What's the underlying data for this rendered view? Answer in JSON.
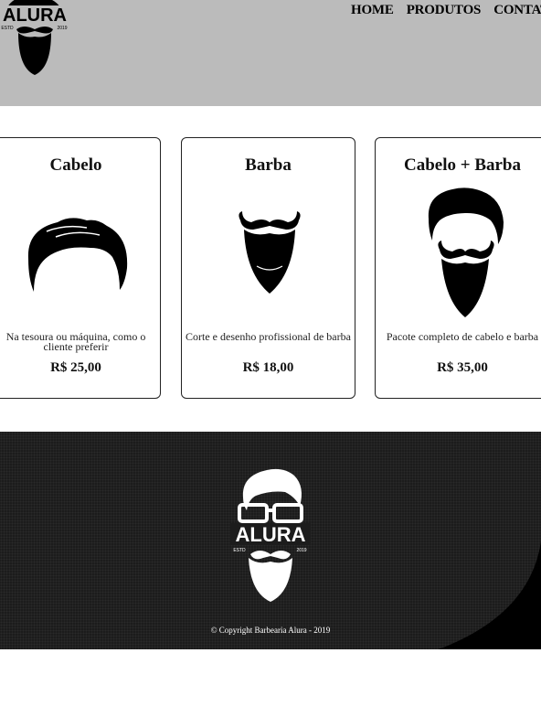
{
  "header": {
    "logo_text": "ALURA",
    "logo_left": "ESTD",
    "logo_right": "2019",
    "nav": [
      "HOME",
      "PRODUTOS",
      "CONTATO"
    ]
  },
  "cards": [
    {
      "title": "Cabelo",
      "desc": "Na tesoura ou máquina, como o cliente preferir",
      "price": "R$ 25,00",
      "icon": "hair-icon"
    },
    {
      "title": "Barba",
      "desc": "Corte e desenho profissional de barba",
      "price": "R$ 18,00",
      "icon": "beard-icon"
    },
    {
      "title": "Cabelo + Barba",
      "desc": "Pacote completo de cabelo e barba",
      "price": "R$ 35,00",
      "icon": "hair-beard-icon"
    }
  ],
  "footer": {
    "logo_text": "ALURA",
    "logo_left": "ESTD",
    "logo_right": "2019",
    "copyright": "© Copyright Barbearia Alura - 2019"
  }
}
